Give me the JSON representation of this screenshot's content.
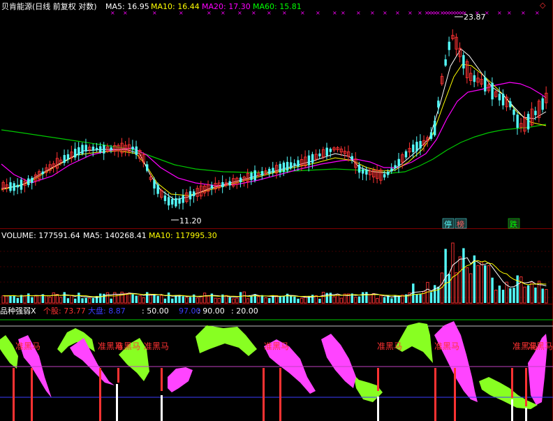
{
  "colors": {
    "background": "#000000",
    "up": "#ff3232",
    "down": "#54fcfc",
    "ma5": "#ffffff",
    "ma10": "#ffff00",
    "ma20": "#ff00ff",
    "ma60": "#00c800",
    "label_yellow": "#ffff00",
    "label_magenta": "#ff00ff",
    "label_green": "#00ff00",
    "label_white": "#ffffff",
    "label_red": "#ff3232",
    "label_blue": "#3c3cff",
    "strength_green": "#88ff22",
    "strength_magenta": "#ff44ff",
    "divider": "#800000"
  },
  "price_panel": {
    "title": "贝肯能源(日线 前复权 对数)",
    "ma5_label": "MA5: 16.95",
    "ma10_label": "MA10: 16.44",
    "ma20_label": "MA20: 17.30",
    "ma60_label": "MA60: 15.81",
    "high_annotation": "23.87",
    "low_annotation": "11.20",
    "badges": [
      "停",
      "榜",
      "跌"
    ],
    "top_diamond": "◇"
  },
  "volume_panel": {
    "volume_label": "VOLUME: 177591.64",
    "ma5_label": "MA5: 140268.41",
    "ma10_label": "MA10: 117995.30"
  },
  "indicator_panel": {
    "title": "品种强弱X",
    "stock_label": "个股: 73.77",
    "market_label": "大盘: 8.87",
    "level_50": ": 50.00",
    "level_97": "97.00",
    "level_90": ": 90.00",
    "level_20": ": 20.00",
    "signal_text": "准黑马"
  },
  "chart_data": {
    "type": "candlestick",
    "price_scale": "log",
    "price_high": 23.87,
    "price_low": 11.2,
    "ma_last": {
      "ma5": 16.95,
      "ma10": 16.44,
      "ma20": 17.3,
      "ma60": 15.81
    },
    "volume_last": {
      "volume": 177591.64,
      "ma5": 140268.41,
      "ma10": 117995.3
    },
    "indicator_last": {
      "stock": 73.77,
      "market": 8.87
    },
    "indicator_levels": [
      97.0,
      90.0,
      50.0,
      20.0
    ]
  }
}
